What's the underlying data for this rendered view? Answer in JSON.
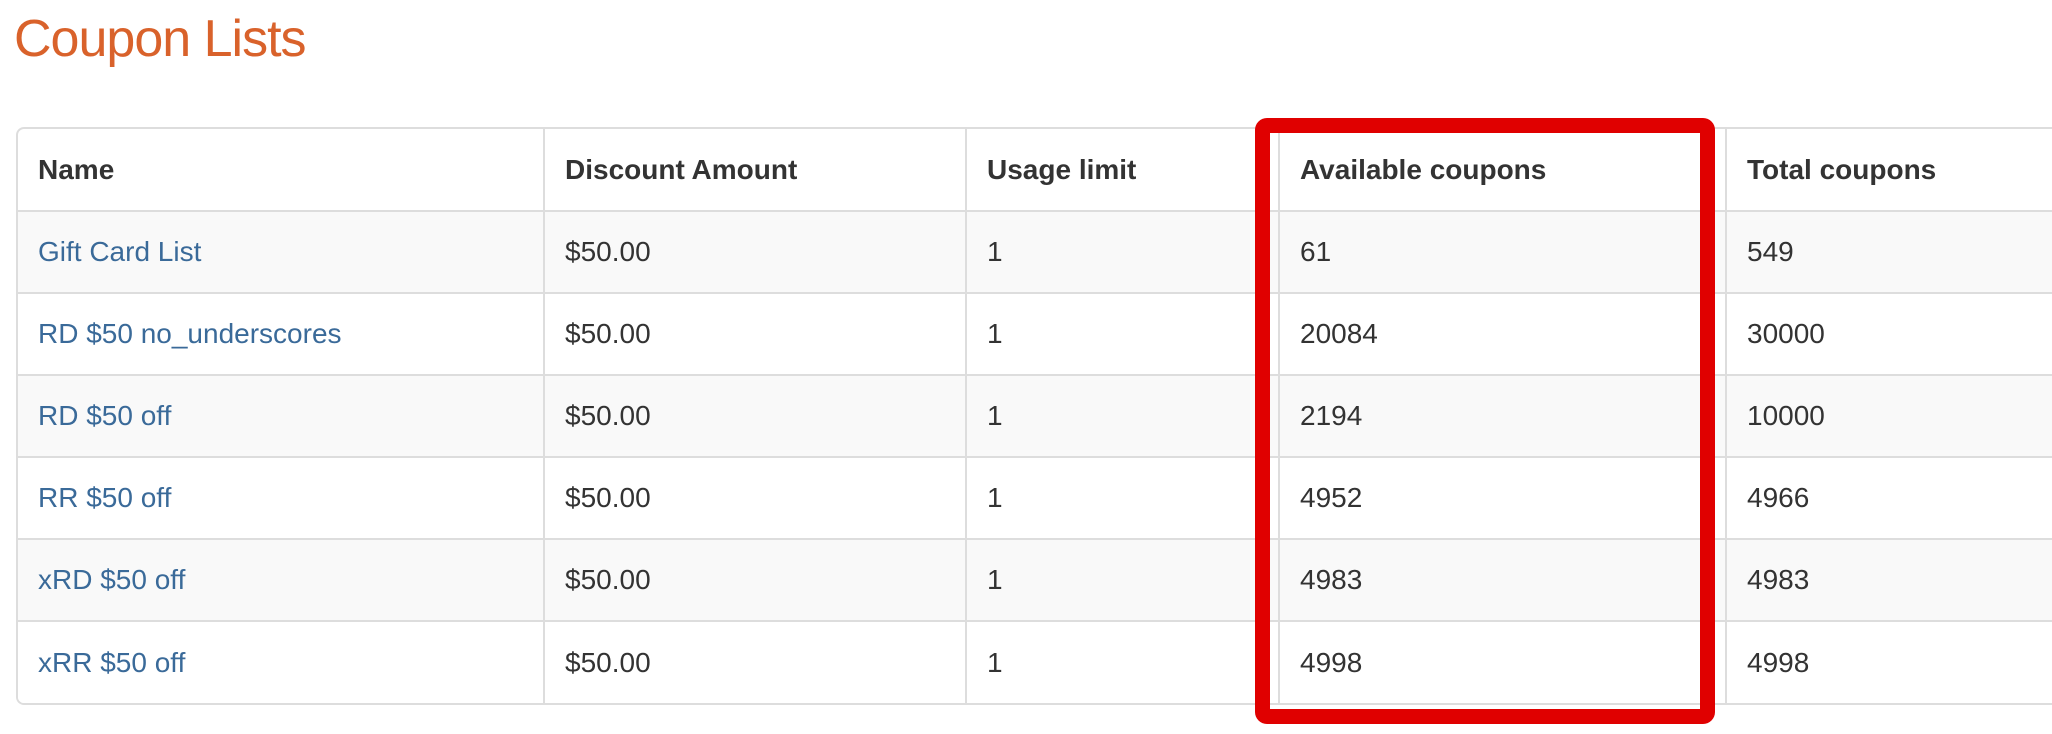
{
  "page": {
    "title": "Coupon Lists"
  },
  "table": {
    "columns": [
      "Name",
      "Discount Amount",
      "Usage limit",
      "Available coupons",
      "Total coupons"
    ],
    "rows": [
      {
        "name": "Gift Card List",
        "discount": "$50.00",
        "usage_limit": "1",
        "available": "61",
        "total": "549"
      },
      {
        "name": "RD $50 no_underscores",
        "discount": "$50.00",
        "usage_limit": "1",
        "available": "20084",
        "total": "30000"
      },
      {
        "name": "RD $50 off",
        "discount": "$50.00",
        "usage_limit": "1",
        "available": "2194",
        "total": "10000"
      },
      {
        "name": "RR $50 off",
        "discount": "$50.00",
        "usage_limit": "1",
        "available": "4952",
        "total": "4966"
      },
      {
        "name": "xRD $50 off",
        "discount": "$50.00",
        "usage_limit": "1",
        "available": "4983",
        "total": "4983"
      },
      {
        "name": "xRR $50 off",
        "discount": "$50.00",
        "usage_limit": "1",
        "available": "4998",
        "total": "4998"
      }
    ]
  },
  "colors": {
    "title": "#d9622b",
    "link": "#3a6a99",
    "highlight": "#e00000",
    "border": "#dddddd",
    "stripe": "#f9f9f9"
  }
}
